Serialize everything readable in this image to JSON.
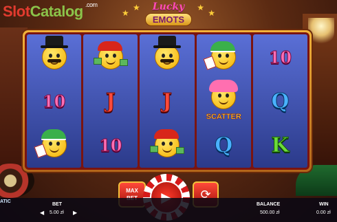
{
  "watermark": {
    "slot": "Slot",
    "catalog": "Catalog",
    "com": ".com"
  },
  "game_logo": {
    "lucky": "Lucky",
    "emots": "EMOTS"
  },
  "reels": [
    [
      {
        "type": "emoji",
        "name": "gentleman-emoji"
      },
      {
        "type": "num",
        "text": "10"
      },
      {
        "type": "emoji",
        "name": "cardplayer-emoji"
      }
    ],
    [
      {
        "type": "emoji",
        "name": "rapper-emoji"
      },
      {
        "type": "J",
        "text": "J"
      },
      {
        "type": "num",
        "text": "10"
      }
    ],
    [
      {
        "type": "emoji",
        "name": "gentleman-emoji"
      },
      {
        "type": "J",
        "text": "J"
      },
      {
        "type": "emoji",
        "name": "rapper-emoji"
      }
    ],
    [
      {
        "type": "emoji",
        "name": "cardplayer-emoji"
      },
      {
        "type": "scatter",
        "name": "scatter-symbol",
        "label": "SCATTER"
      },
      {
        "type": "Q",
        "text": "Q"
      }
    ],
    [
      {
        "type": "num",
        "text": "10"
      },
      {
        "type": "Q",
        "text": "Q"
      },
      {
        "type": "K",
        "text": "K"
      }
    ]
  ],
  "controls": {
    "maxbet_line1": "MAX",
    "maxbet_line2": "BET"
  },
  "bottom": {
    "bet_label": "BET",
    "bet_value": "5.00 zł",
    "balance_label": "BALANCE",
    "balance_value": "500.00 zł",
    "win_label": "WIN",
    "win_value": "0.00 zł"
  },
  "provider": {
    "text": "ATIC"
  },
  "colors": {
    "frame": "#f2b23a",
    "reel_bg": "#3b4fb8",
    "spin": "#d61a1a"
  }
}
